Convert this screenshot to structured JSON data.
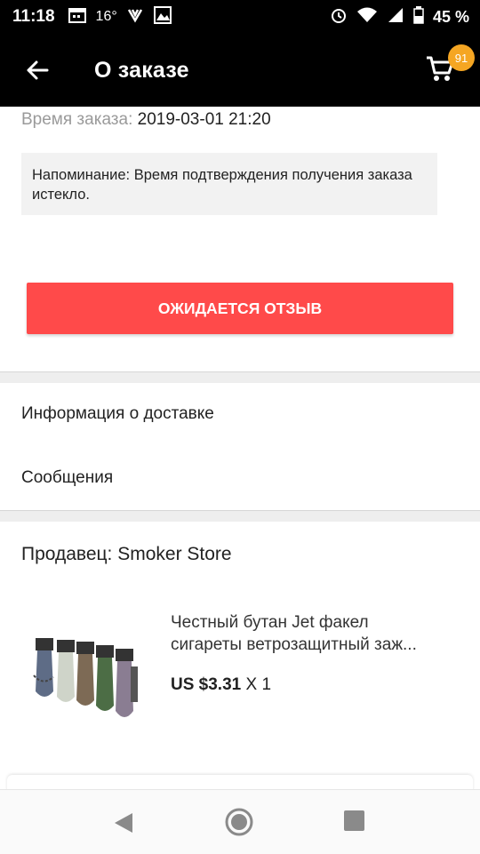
{
  "status_bar": {
    "time": "11:18",
    "temp": "16°",
    "battery": "45 %",
    "icons": [
      "calendar-icon",
      "download-icon",
      "gallery-icon",
      "alarm-icon",
      "wifi-icon",
      "signal-icon",
      "battery-icon"
    ]
  },
  "app_bar": {
    "title": "О заказе",
    "cart_count": "91",
    "accent": "#f5a623"
  },
  "order": {
    "time_label": "Время заказа:",
    "time_value": "2019-03-01 21:20",
    "reminder": "Напоминание: Время подтверждения получения заказа истекло.",
    "review_button": "ОЖИДАЕТСЯ ОТЗЫВ",
    "button_color": "#ff4a4a"
  },
  "menu": {
    "delivery_info": "Информация о доставке",
    "messages": "Сообщения"
  },
  "seller": {
    "label": "Продавец: Smoker Store"
  },
  "product": {
    "name_line1": "Честный бутан Jet факел",
    "name_line2": "сигареты ветрозащитный заж...",
    "price": "US $3.31",
    "quantity": "X 1"
  }
}
